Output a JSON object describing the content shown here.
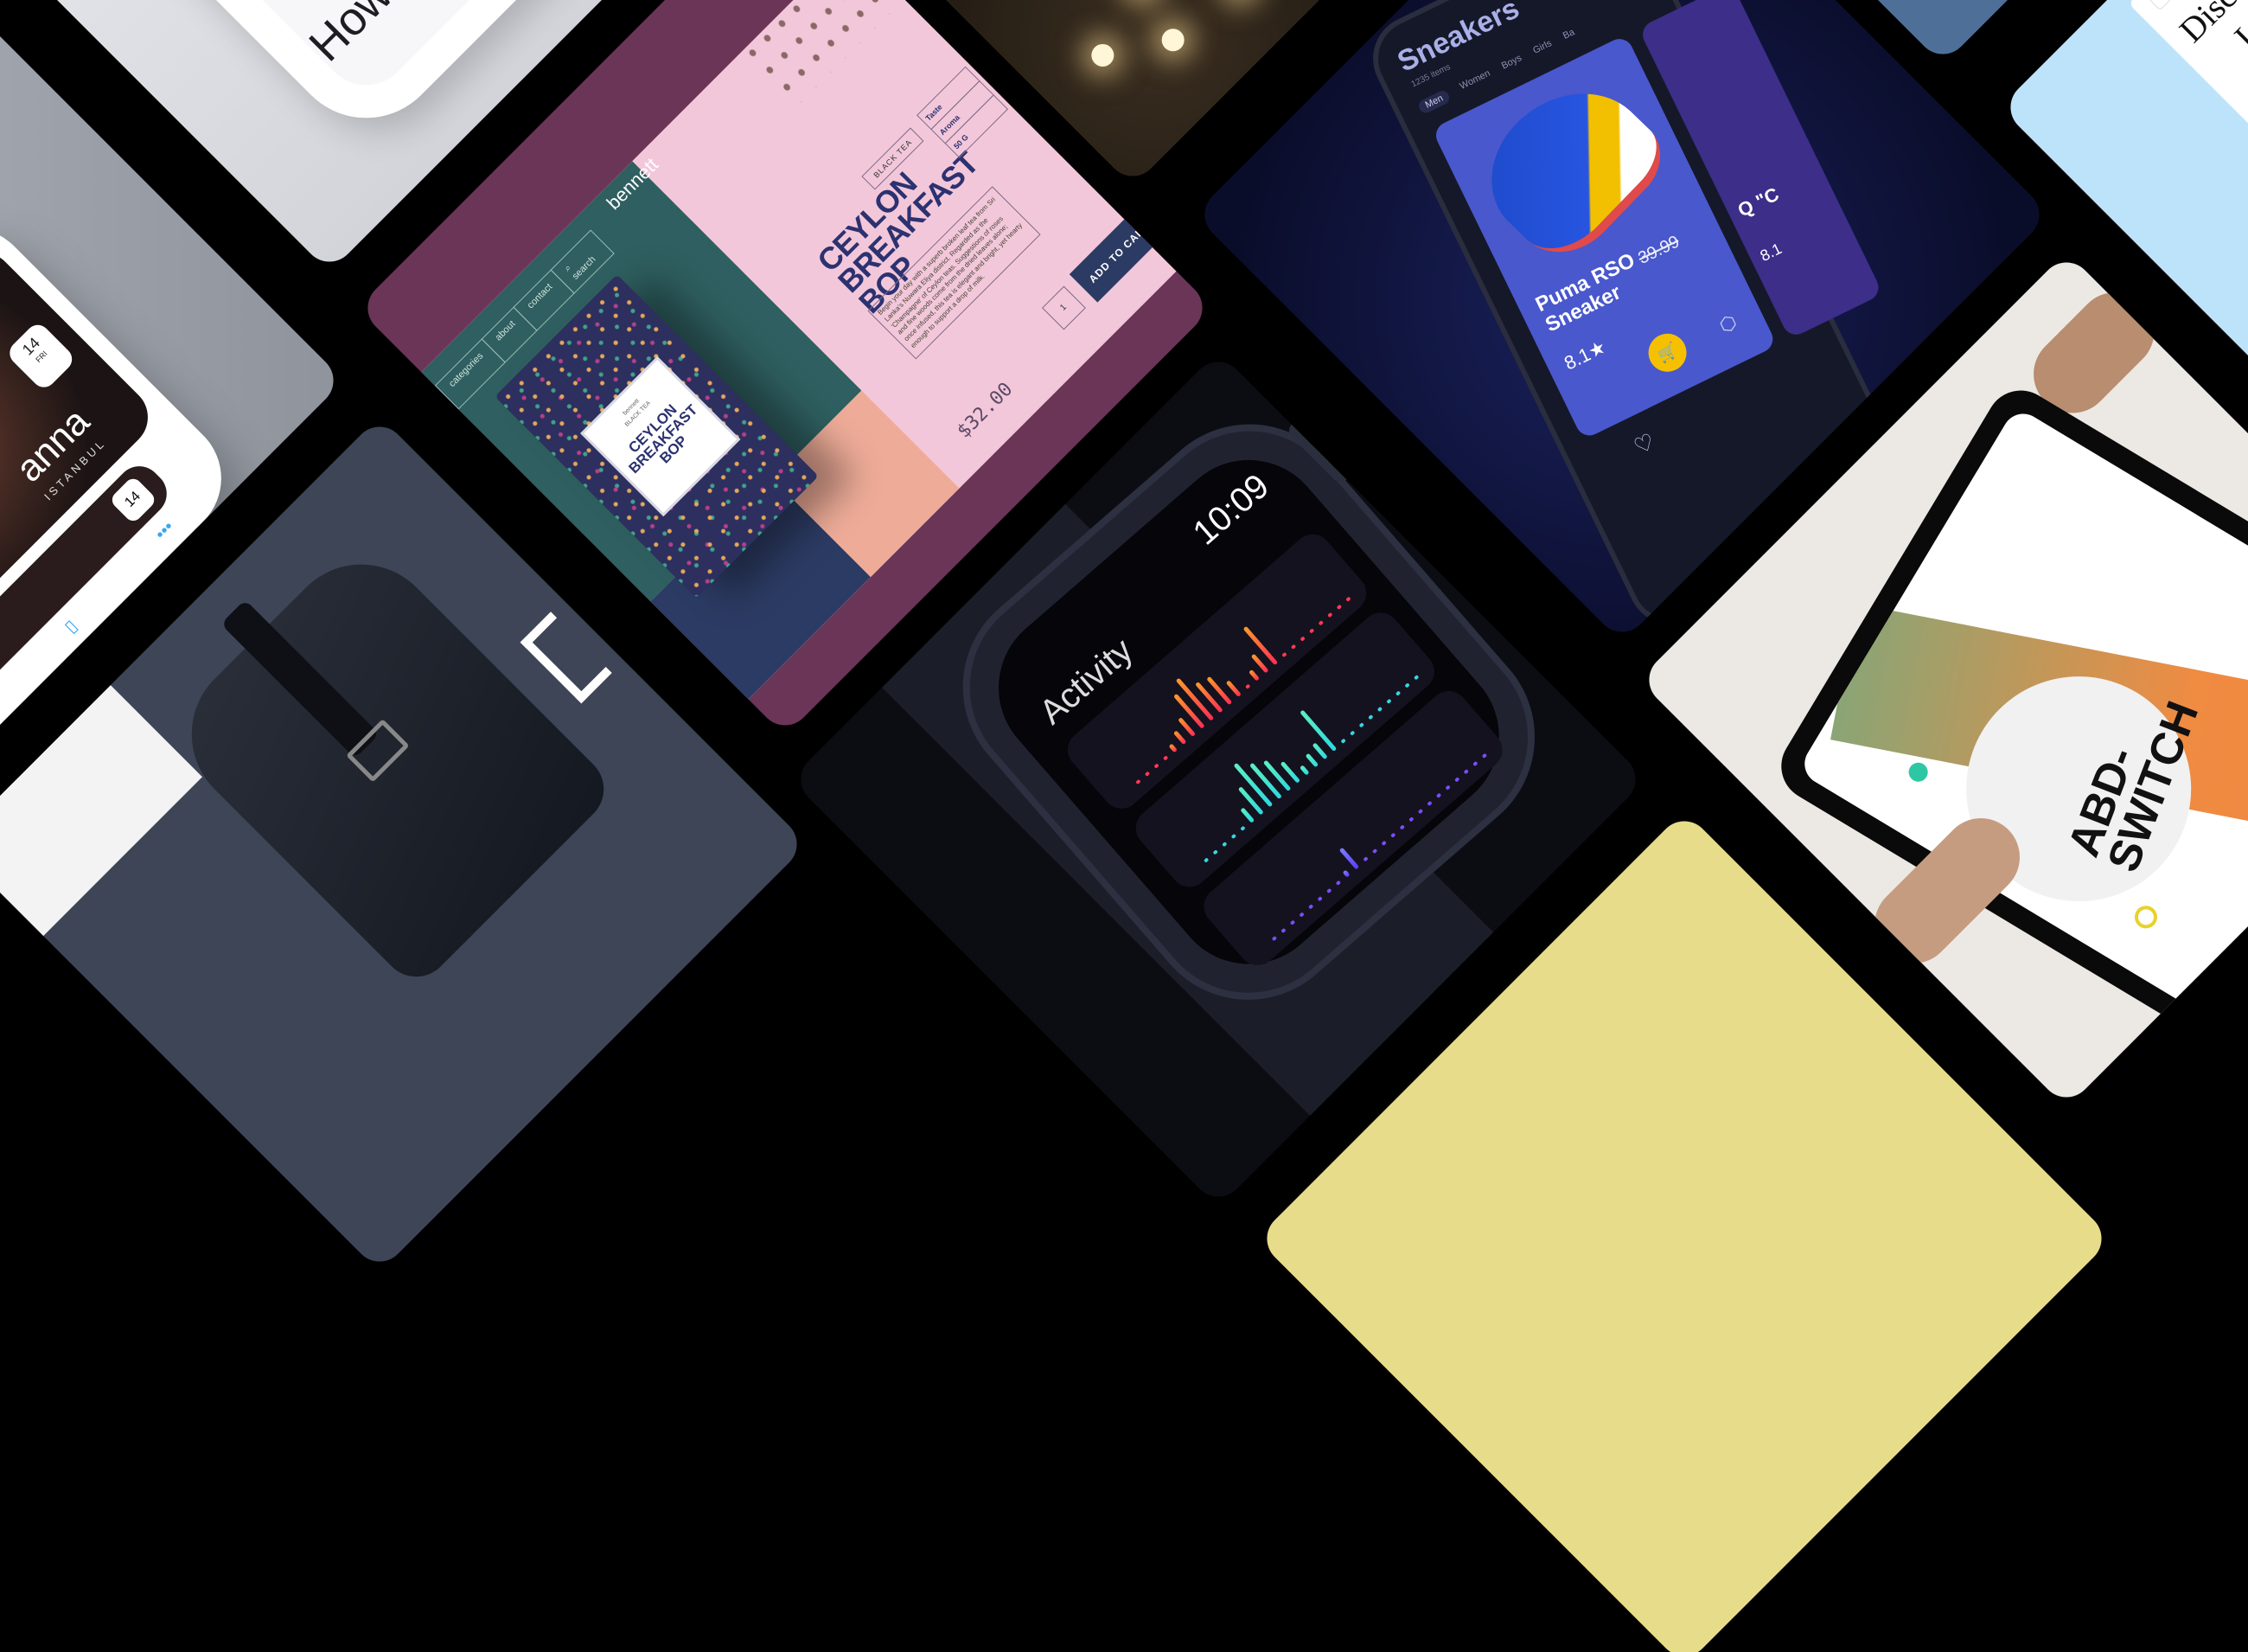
{
  "colors": {
    "background": "#000000",
    "tea_frame": "#6b3557",
    "tea_teal": "#2f5f60",
    "tea_pink": "#f3c7da",
    "tea_navy": "#2c3b63",
    "tea_peach": "#eeac98",
    "sneaker_card": "#4958cc",
    "sneaker_bg": "#0a0d2a",
    "cart_yellow": "#f5c000",
    "watch_bg": "#0c0d13",
    "sky": "#bde3fa",
    "steel": "#4e7098"
  },
  "how_tile": {
    "text": "How"
  },
  "profile_tile": {
    "date_day": "14",
    "date_weekday": "FRI",
    "name": "anna",
    "city": "ISTANBUL",
    "second_date": "14",
    "more_icon": "ellipsis-icon",
    "home_icon": "home-icon",
    "bookmark_icon": "bookmark-icon"
  },
  "tea_tile": {
    "brand": "bennett",
    "nav": [
      "categories",
      "about",
      "contact",
      "search"
    ],
    "category": "BLACK TEA",
    "title_line1": "CEYLON",
    "title_line2": "BREAKFAST BOP",
    "props": [
      "Taste",
      "Aroma",
      "50 G"
    ],
    "description": "Begin your day with a superb broken leaf tea from Sri Lanka's Nuwara Eliya district. Regarded as the 'Champagne' of Ceylon teas. Suggestions of roses and fine woods come from the dried leaves alone; once infused, this tea is elegant and bright, yet hearty enough to support a drop of milk.",
    "quantity": "1",
    "add_to_cart": "ADD TO CART",
    "price": "$32.00",
    "box_label_brand": "bennett",
    "box_label_category": "BLACK TEA",
    "box_label_title": "CEYLON BREAKFAST BOP"
  },
  "sneaker_tile": {
    "header": "Sneakers",
    "count": "1235 items",
    "tabs": [
      "Men",
      "Women",
      "Boys",
      "Girls",
      "Ba"
    ],
    "product_name": "Puma RSO Sneaker",
    "old_price": "39.99",
    "rating": "8.1★",
    "second_card_title": "Q \"C",
    "second_card_rating": "8.1",
    "cart_icon": "cart-icon",
    "heart_icon": "heart-icon",
    "cube_icon": "3d-cube-icon"
  },
  "watch_tile": {
    "title": "Activity",
    "time": "10:09",
    "bar_colors": [
      "#ff3a55",
      "#38d6e0",
      "#7a4dff"
    ]
  },
  "sky_tile": {
    "search_icon": "search-icon",
    "heading": "Disc",
    "subheading": "L"
  },
  "abd_tile": {
    "title_line1": "ABD-",
    "title_line2": "SWITCH"
  }
}
